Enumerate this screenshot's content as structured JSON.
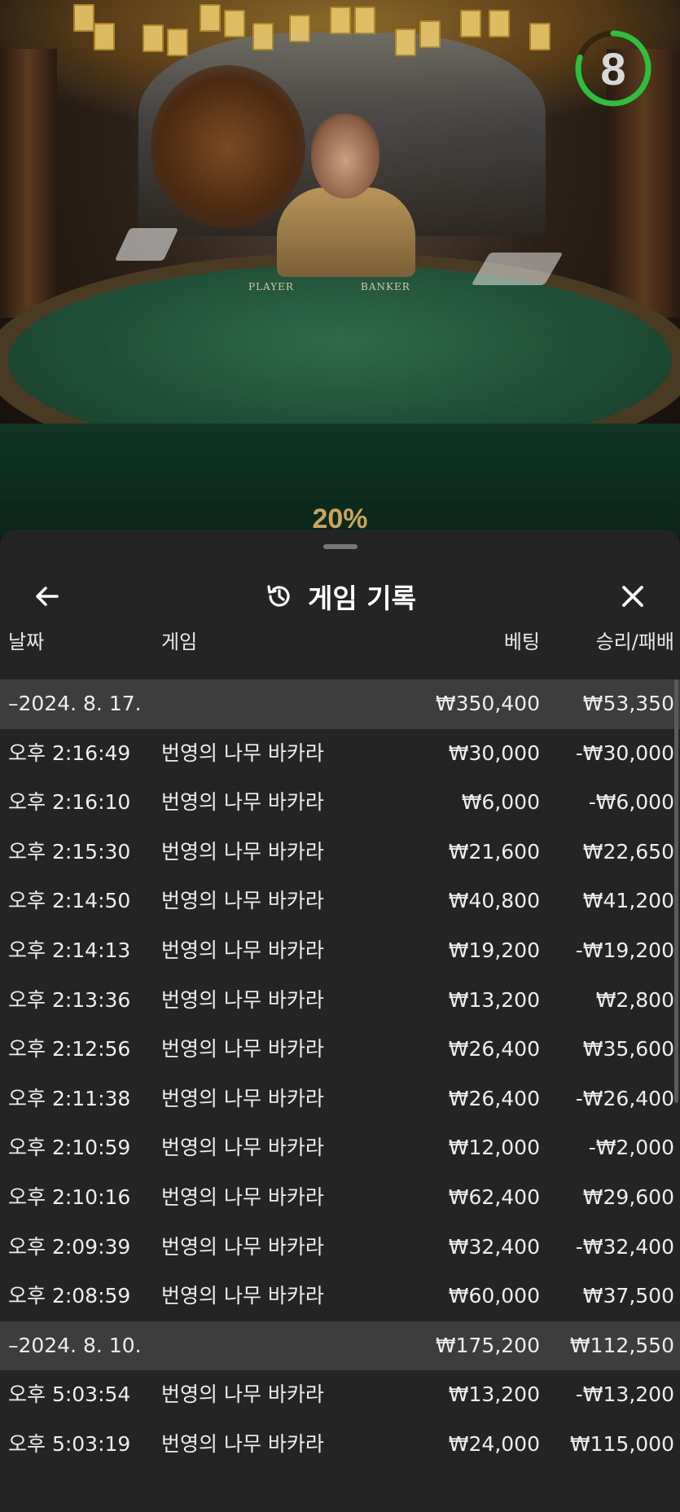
{
  "video": {
    "table_labels": {
      "player": "PLAYER",
      "banker": "BANKER"
    },
    "timer": {
      "seconds": "8",
      "progress": 0.8,
      "color": "#2fbf3f"
    },
    "percent": "20%"
  },
  "panel": {
    "title": "게임 기록",
    "title_icon": "history-icon",
    "back_icon": "arrow-left-icon",
    "close_icon": "close-icon",
    "columns": {
      "date": "날짜",
      "game": "게임",
      "bet": "베팅",
      "win_loss": "승리/패배"
    },
    "rows": [
      {
        "type": "date",
        "time": "–2024. 8. 17.",
        "game": "",
        "bet": "₩350,400",
        "wl": "₩53,350"
      },
      {
        "type": "game",
        "time": "오후 2:16:49",
        "game": "번영의 나무 바카라",
        "bet": "₩30,000",
        "wl": "-₩30,000"
      },
      {
        "type": "game",
        "time": "오후 2:16:10",
        "game": "번영의 나무 바카라",
        "bet": "₩6,000",
        "wl": "-₩6,000"
      },
      {
        "type": "game",
        "time": "오후 2:15:30",
        "game": "번영의 나무 바카라",
        "bet": "₩21,600",
        "wl": "₩22,650"
      },
      {
        "type": "game",
        "time": "오후 2:14:50",
        "game": "번영의 나무 바카라",
        "bet": "₩40,800",
        "wl": "₩41,200"
      },
      {
        "type": "game",
        "time": "오후 2:14:13",
        "game": "번영의 나무 바카라",
        "bet": "₩19,200",
        "wl": "-₩19,200"
      },
      {
        "type": "game",
        "time": "오후 2:13:36",
        "game": "번영의 나무 바카라",
        "bet": "₩13,200",
        "wl": "₩2,800"
      },
      {
        "type": "game",
        "time": "오후 2:12:56",
        "game": "번영의 나무 바카라",
        "bet": "₩26,400",
        "wl": "₩35,600"
      },
      {
        "type": "game",
        "time": "오후 2:11:38",
        "game": "번영의 나무 바카라",
        "bet": "₩26,400",
        "wl": "-₩26,400"
      },
      {
        "type": "game",
        "time": "오후 2:10:59",
        "game": "번영의 나무 바카라",
        "bet": "₩12,000",
        "wl": "-₩2,000"
      },
      {
        "type": "game",
        "time": "오후 2:10:16",
        "game": "번영의 나무 바카라",
        "bet": "₩62,400",
        "wl": "₩29,600"
      },
      {
        "type": "game",
        "time": "오후 2:09:39",
        "game": "번영의 나무 바카라",
        "bet": "₩32,400",
        "wl": "-₩32,400"
      },
      {
        "type": "game",
        "time": "오후 2:08:59",
        "game": "번영의 나무 바카라",
        "bet": "₩60,000",
        "wl": "₩37,500"
      },
      {
        "type": "date",
        "time": "–2024. 8. 10.",
        "game": "",
        "bet": "₩175,200",
        "wl": "₩112,550"
      },
      {
        "type": "game",
        "time": "오후 5:03:54",
        "game": "번영의 나무 바카라",
        "bet": "₩13,200",
        "wl": "-₩13,200"
      },
      {
        "type": "game",
        "time": "오후 5:03:19",
        "game": "번영의 나무 바카라",
        "bet": "₩24,000",
        "wl": "₩115,000"
      }
    ]
  }
}
